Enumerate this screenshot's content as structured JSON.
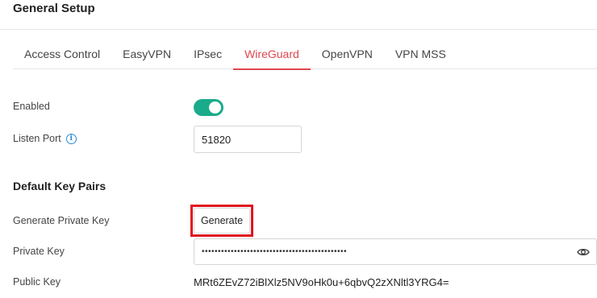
{
  "header": {
    "title": "General Setup"
  },
  "tabs": [
    {
      "label": "Access Control",
      "active": false
    },
    {
      "label": "EasyVPN",
      "active": false
    },
    {
      "label": "IPsec",
      "active": false
    },
    {
      "label": "WireGuard",
      "active": true
    },
    {
      "label": "OpenVPN",
      "active": false
    },
    {
      "label": "VPN MSS",
      "active": false
    }
  ],
  "form": {
    "enabled": {
      "label": "Enabled",
      "value": true
    },
    "listen_port": {
      "label": "Listen Port",
      "value": "51820",
      "info_icon": "info-icon"
    },
    "key_pairs": {
      "title": "Default Key Pairs",
      "generate": {
        "label": "Generate Private Key",
        "button_label": "Generate"
      },
      "private_key": {
        "label": "Private Key",
        "masked_value": "•••••••••••••••••••••••••••••••••••••••••••••",
        "icon": "eye-icon"
      },
      "public_key": {
        "label": "Public Key",
        "value": "MRt6ZEvZ72iBlXlz5NV9oHk0u+6qbvQ2zXNltl3YRG4="
      }
    }
  },
  "colors": {
    "accent": "#e0464f",
    "toggle_on": "#1aab8b",
    "highlight": "#e0141e",
    "info": "#2a8ad4"
  }
}
